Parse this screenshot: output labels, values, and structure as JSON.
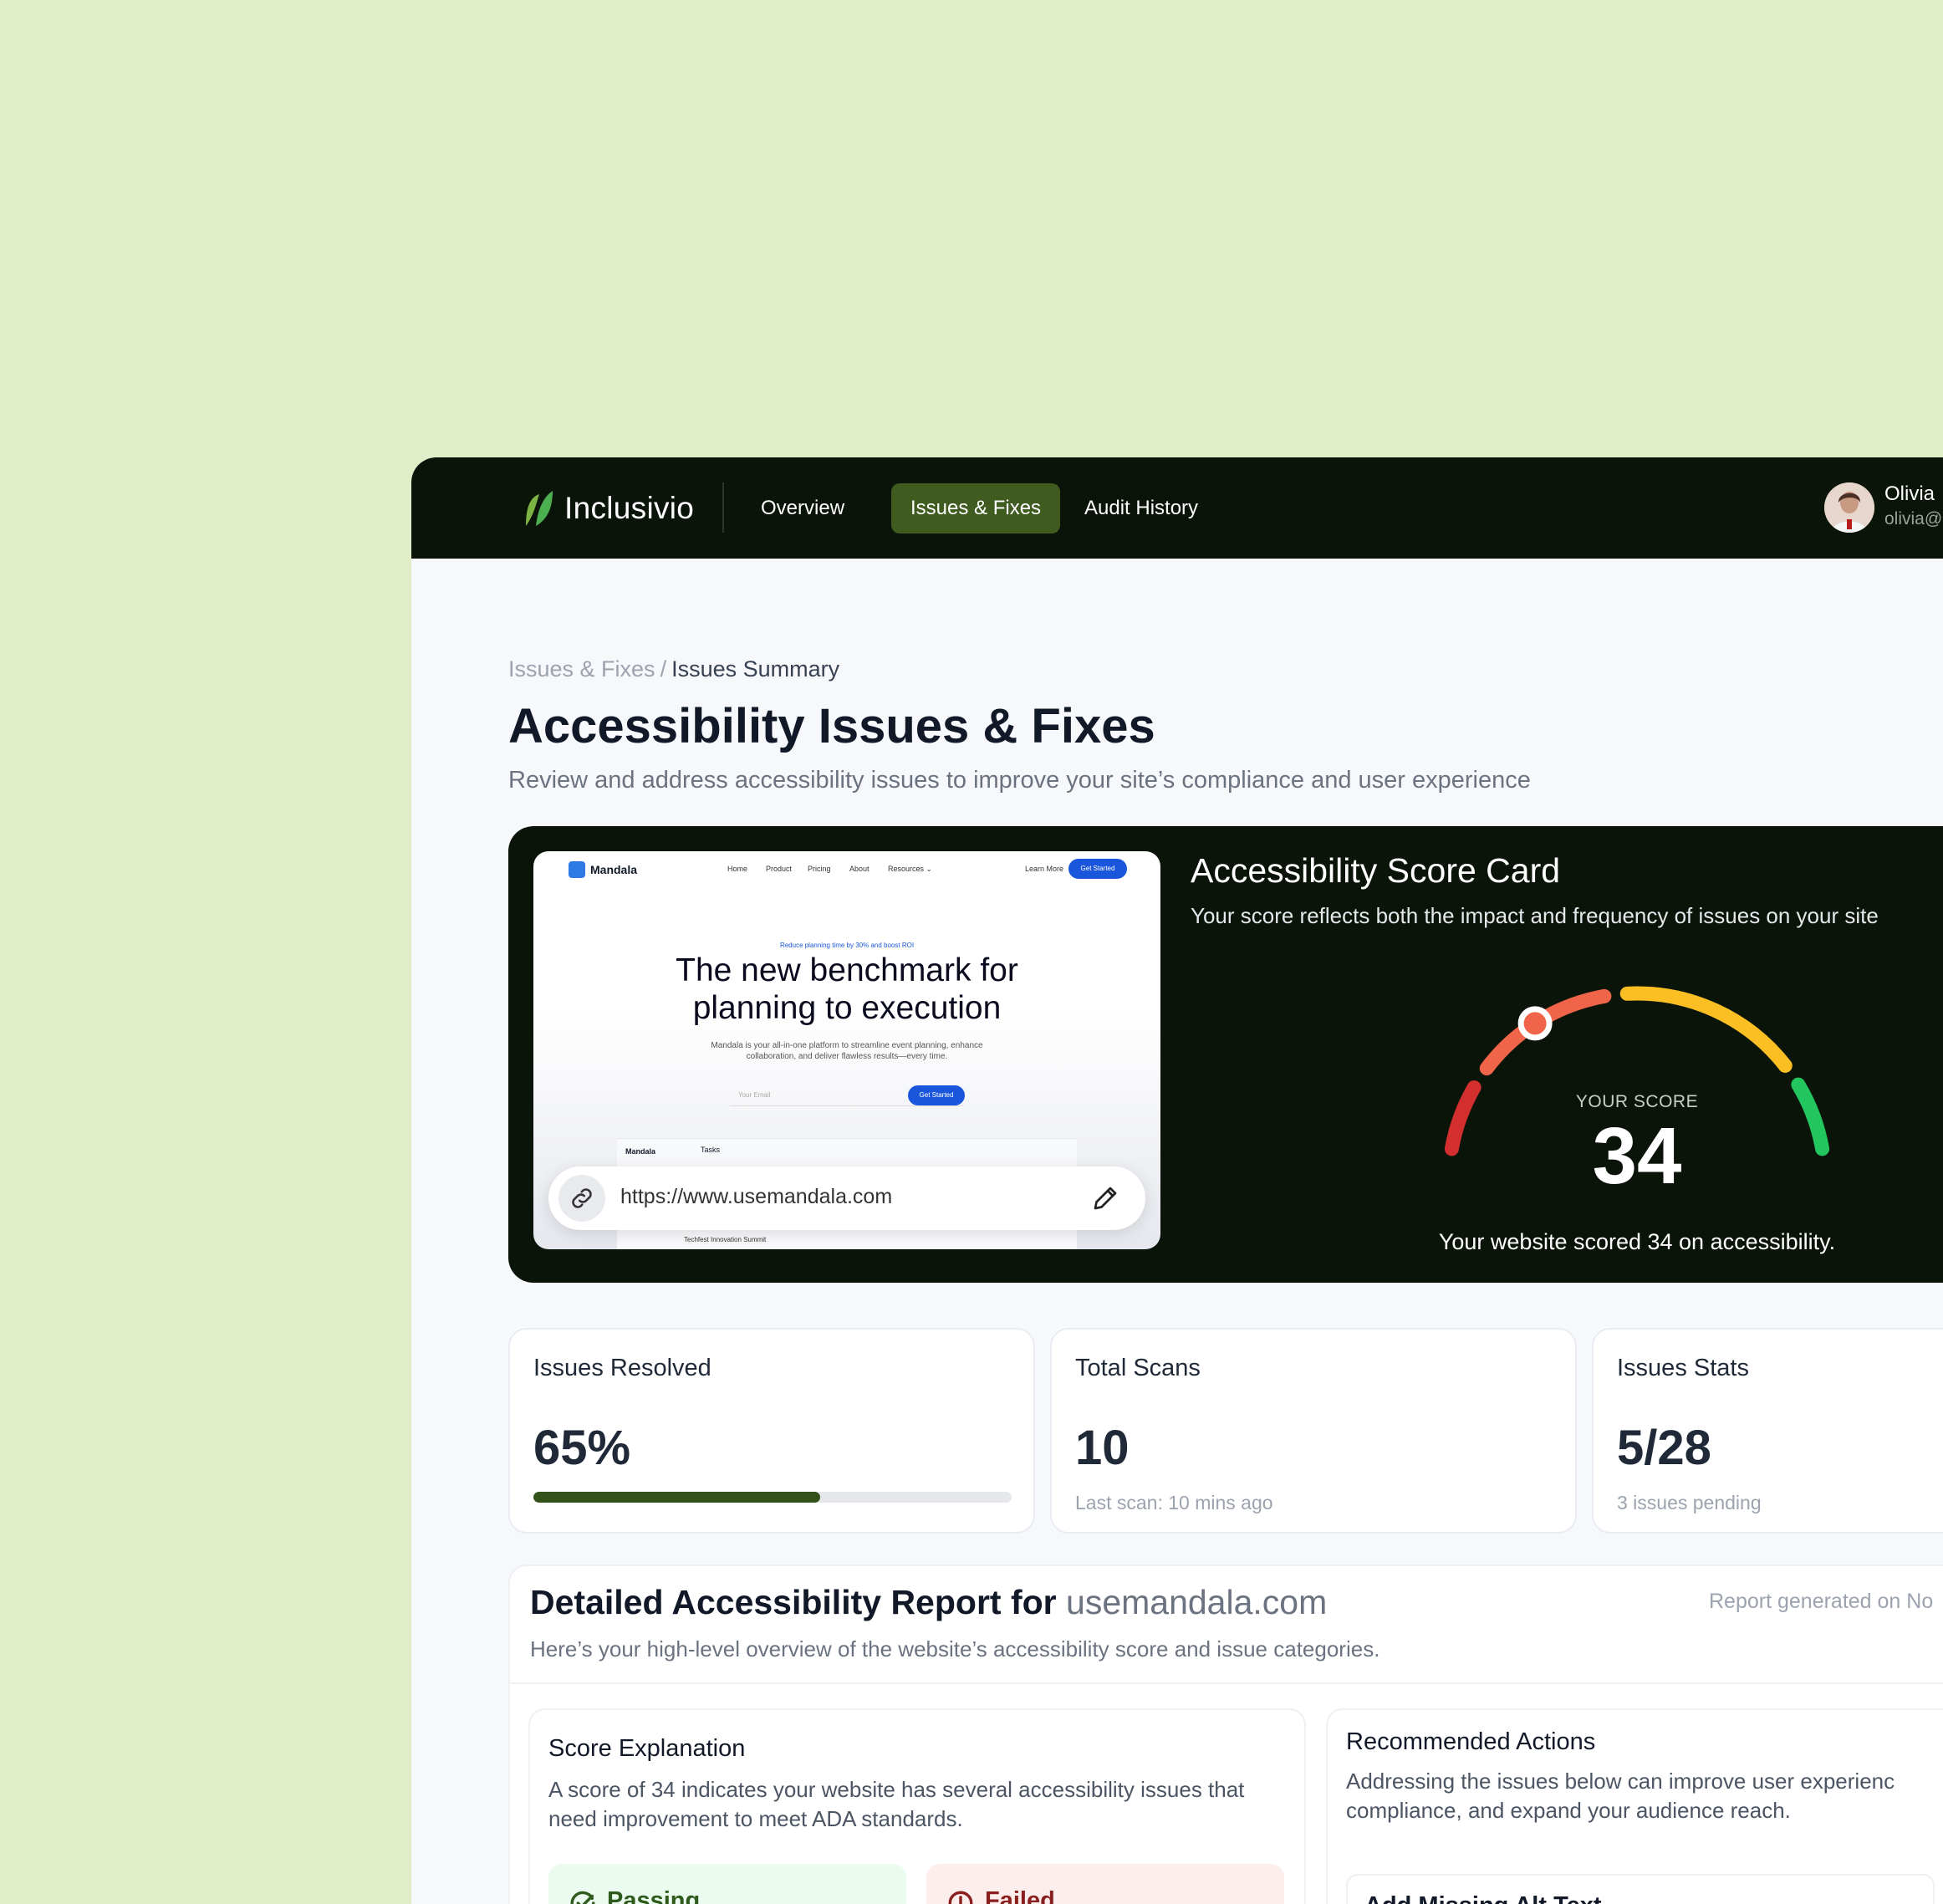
{
  "app": {
    "name": "Inclusivio",
    "brand_color": "#3f5b20"
  },
  "nav": [
    {
      "label": "Overview",
      "active": false
    },
    {
      "label": "Issues & Fixes",
      "active": true
    },
    {
      "label": "Audit History",
      "active": false
    }
  ],
  "user": {
    "name": "Olivia",
    "email": "olivia@"
  },
  "breadcrumb": {
    "parent": "Issues & Fixes",
    "separator": "/",
    "current": "Issues Summary"
  },
  "page": {
    "title": "Accessibility Issues & Fixes",
    "subtitle": "Review and address accessibility issues to improve your site’s compliance and user experience"
  },
  "preview": {
    "brand": "Mandala",
    "nav": [
      "Home",
      "Product",
      "Pricing",
      "About",
      "Resources ⌄"
    ],
    "learn_more": "Learn More",
    "get_started": "Get Started",
    "tagline": "Reduce planning time by 30% and boost ROI",
    "headline_1": "The new benchmark for",
    "headline_2": "planning to execution",
    "description": "Mandala is your all-in-one platform to streamline event planning, enhance collaboration, and deliver flawless results—every time.",
    "email_placeholder": "Your Email",
    "app_brand": "Mandala",
    "app_section": "Tasks",
    "app_event": "Techfest Innovation Summit",
    "url": "https://www.usemandala.com"
  },
  "score_card": {
    "title": "Accessibility Score Card",
    "subtitle": "Your score reflects both the impact and frequency of issues on your site",
    "score_label": "YOUR SCORE",
    "score": 34,
    "score_max": 100,
    "message": "Your website scored 34 on accessibility.",
    "colors": {
      "red": "#d32f2f",
      "orange": "#f06449",
      "yellow": "#fbbf24",
      "green": "#22c55e"
    }
  },
  "stats": [
    {
      "label": "Issues Resolved",
      "value": "65%",
      "progress": 0.6
    },
    {
      "label": "Total Scans",
      "value": "10",
      "note": "Last scan: 10 mins ago"
    },
    {
      "label": "Issues Stats",
      "value": "5/28",
      "note": "3 issues pending"
    }
  ],
  "report": {
    "title_prefix": "Detailed Accessibility Report for",
    "domain": "usemandala.com",
    "date": "Report generated on No",
    "subtitle": "Here’s your high-level overview of the website’s accessibility score and issue categories.",
    "score_explanation": {
      "title": "Score Explanation",
      "text": "A score of 34 indicates your website has several accessibility issues that need improvement to meet ADA standards.",
      "passing_label": "Passing",
      "failed_label": "Failed"
    },
    "recommended": {
      "title": "Recommended Actions",
      "text": " Addressing the issues below can improve user experienc compliance, and expand your audience reach.",
      "first_action": "Add Missing Alt Text"
    }
  }
}
